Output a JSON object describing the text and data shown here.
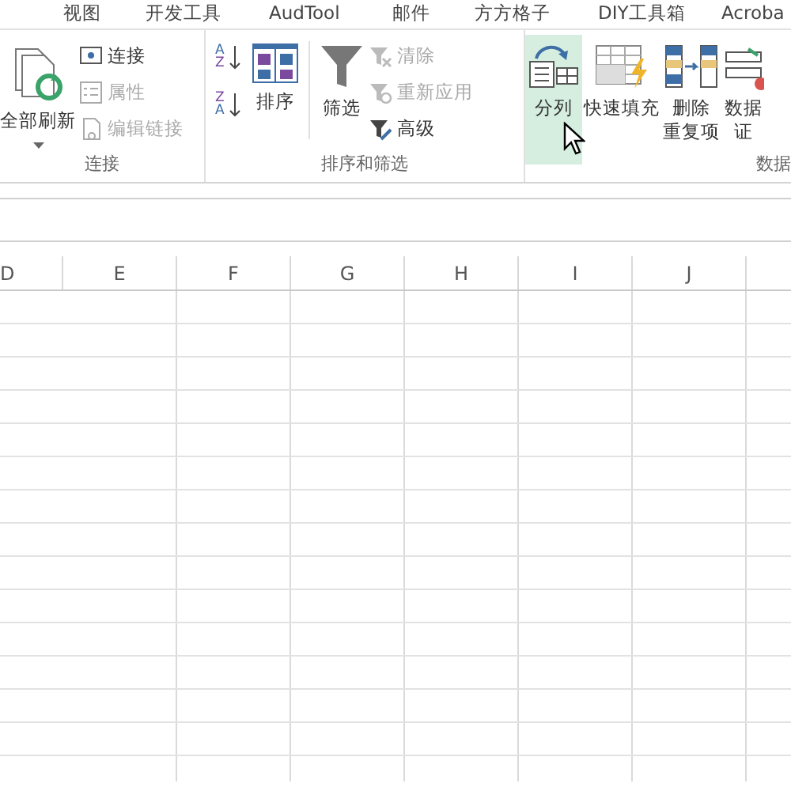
{
  "tabs": [
    {
      "label": "视图"
    },
    {
      "label": "开发工具"
    },
    {
      "label": "AudTool"
    },
    {
      "label": "邮件"
    },
    {
      "label": "方方格子"
    },
    {
      "label": "DIY工具箱"
    },
    {
      "label": "Acroba"
    }
  ],
  "ribbon": {
    "groups": [
      {
        "label": "连接",
        "items": [
          {
            "kind": "large",
            "label": [
              "全部刷新"
            ],
            "caret": true,
            "selected": false
          },
          {
            "kind": "stack",
            "items": [
              {
                "kind": "small",
                "label": "连接",
                "disabled": false
              },
              {
                "kind": "small",
                "label": "属性",
                "disabled": true
              },
              {
                "kind": "small",
                "label": "编辑链接",
                "disabled": true
              }
            ]
          }
        ]
      },
      {
        "label": "排序和筛选",
        "items": [
          {
            "kind": "stack",
            "items": [
              {
                "kind": "icon",
                "letters": [
                  "A",
                  "Z"
                ]
              },
              {
                "kind": "icon",
                "letters": [
                  "Z",
                  "A"
                ]
              }
            ]
          },
          {
            "kind": "large",
            "label": [
              "排序"
            ],
            "caret": false,
            "selected": false
          },
          {
            "kind": "separator"
          },
          {
            "kind": "large",
            "label": [
              "筛选"
            ],
            "caret": false,
            "selected": false
          },
          {
            "kind": "stack",
            "items": [
              {
                "kind": "small",
                "label": "清除",
                "disabled": true
              },
              {
                "kind": "small",
                "label": "重新应用",
                "disabled": true
              },
              {
                "kind": "small",
                "label": "高级",
                "disabled": false
              }
            ]
          }
        ]
      },
      {
        "label": "数据",
        "items": [
          {
            "kind": "large",
            "label": [
              "分列"
            ],
            "caret": false,
            "selected": true
          },
          {
            "kind": "large",
            "label": [
              "快速填充"
            ],
            "caret": false,
            "selected": false
          },
          {
            "kind": "large",
            "label": [
              "删除",
              "重复项"
            ],
            "caret": false,
            "selected": false
          },
          {
            "kind": "large",
            "label": [
              "数据",
              "证"
            ],
            "caret": false,
            "selected": false
          }
        ]
      }
    ]
  },
  "columns": [
    "D",
    "E",
    "F",
    "G",
    "H",
    "I",
    "J"
  ]
}
